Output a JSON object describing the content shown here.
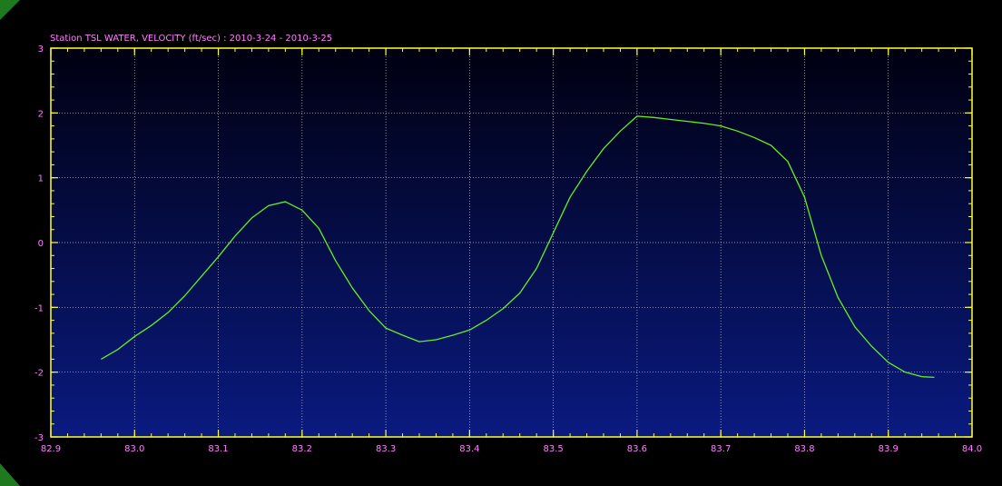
{
  "chart_data": {
    "type": "line",
    "title": "Station TSL WATER, VELOCITY (ft/sec) : 2010-3-24 - 2010-3-25",
    "xlabel": "",
    "ylabel": "",
    "xlim": [
      82.9,
      84.0
    ],
    "ylim": [
      -3,
      3
    ],
    "x_ticks": [
      "82.9",
      "83.0",
      "83.1",
      "83.2",
      "83.3",
      "83.4",
      "83.5",
      "83.6",
      "83.7",
      "83.8",
      "83.9",
      "84.0"
    ],
    "y_ticks": [
      "3",
      "2",
      "1",
      "0",
      "-1",
      "-2",
      "-3"
    ],
    "grid": true,
    "colors": {
      "background_top": "#000010",
      "background_bottom": "#0a1a80",
      "frame": "#ffff33",
      "grid": "#c8c8c8",
      "line": "#66ee22",
      "text": "#ff80ff",
      "corner_accent": "#1f7a1f"
    },
    "series": [
      {
        "x": [
          82.96,
          82.98,
          83.0,
          83.02,
          83.04,
          83.06,
          83.08,
          83.1,
          83.12,
          83.14,
          83.16,
          83.18,
          83.2,
          83.22,
          83.24,
          83.26,
          83.28,
          83.3,
          83.32,
          83.34,
          83.36,
          83.38,
          83.4,
          83.42,
          83.44,
          83.46,
          83.48,
          83.5,
          83.52,
          83.54,
          83.56,
          83.58,
          83.6,
          83.62,
          83.64,
          83.66,
          83.68,
          83.7,
          83.72,
          83.74,
          83.76,
          83.78,
          83.8,
          83.82,
          83.84,
          83.86,
          83.88,
          83.9,
          83.92,
          83.94,
          83.955
        ],
        "y": [
          -1.8,
          -1.65,
          -1.45,
          -1.28,
          -1.08,
          -0.82,
          -0.52,
          -0.22,
          0.1,
          0.38,
          0.57,
          0.63,
          0.5,
          0.22,
          -0.28,
          -0.7,
          -1.05,
          -1.32,
          -1.43,
          -1.53,
          -1.5,
          -1.43,
          -1.35,
          -1.2,
          -1.02,
          -0.78,
          -0.4,
          0.15,
          0.7,
          1.1,
          1.45,
          1.72,
          1.95,
          1.93,
          1.9,
          1.87,
          1.84,
          1.8,
          1.72,
          1.62,
          1.5,
          1.25,
          0.7,
          -0.2,
          -0.85,
          -1.3,
          -1.6,
          -1.85,
          -2.0,
          -2.07,
          -2.08
        ]
      }
    ]
  }
}
